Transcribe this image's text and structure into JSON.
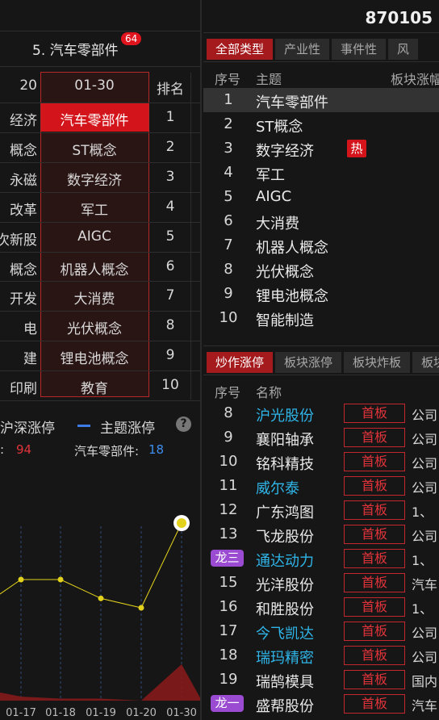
{
  "left": {
    "sector_title": "5. 汽车零部件",
    "sector_badge": "64",
    "header_left": "20",
    "header_mid": "01-30",
    "header_rank": "排名",
    "rows": [
      {
        "left": "经济",
        "mid": "汽车零部件",
        "rank": "1"
      },
      {
        "left": "概念",
        "mid": "ST概念",
        "rank": "2"
      },
      {
        "left": "永磁",
        "mid": "数字经济",
        "rank": "3"
      },
      {
        "left": "改革",
        "mid": "军工",
        "rank": "4"
      },
      {
        "left": "次新股",
        "mid": "AIGC",
        "rank": "5"
      },
      {
        "left": "概念",
        "mid": "机器人概念",
        "rank": "6"
      },
      {
        "left": "开发",
        "mid": "大消费",
        "rank": "7"
      },
      {
        "left": "电",
        "mid": "光伏概念",
        "rank": "8"
      },
      {
        "left": "建",
        "mid": "锂电池概念",
        "rank": "9"
      },
      {
        "left": "印刷",
        "mid": "教育",
        "rank": "10"
      }
    ],
    "legend_a": "沪深涨停",
    "legend_b": "主题涨停",
    "help_icon": "?",
    "stat_a_label": ":",
    "stat_a_value": "94",
    "stat_b_label": "汽车零部件:",
    "stat_b_value": "18"
  },
  "chart_data": {
    "type": "line",
    "x": [
      "01-17",
      "01-18",
      "01-19",
      "01-20",
      "01-30"
    ],
    "series": [
      {
        "values": [
          null,
          12,
          12,
          10,
          9,
          18
        ]
      }
    ],
    "colors": {
      "line": "#e3d21c",
      "area": "#8b1a1a",
      "grid": "#2f4a7a"
    }
  },
  "right": {
    "code": "870105",
    "theme_tabs": [
      "全部类型",
      "产业性",
      "事件性",
      "风"
    ],
    "theme_header": {
      "no": "序号",
      "name": "主题",
      "pct": "板块涨幅"
    },
    "themes": [
      {
        "no": "1",
        "name": "汽车零部件"
      },
      {
        "no": "2",
        "name": "ST概念"
      },
      {
        "no": "3",
        "name": "数字经济",
        "hot": "热"
      },
      {
        "no": "4",
        "name": "军工"
      },
      {
        "no": "5",
        "name": "AIGC"
      },
      {
        "no": "6",
        "name": "大消费"
      },
      {
        "no": "7",
        "name": "机器人概念"
      },
      {
        "no": "8",
        "name": "光伏概念"
      },
      {
        "no": "9",
        "name": "锂电池概念"
      },
      {
        "no": "10",
        "name": "智能制造"
      }
    ],
    "stock_tabs": [
      "炒作涨停",
      "板块涨停",
      "板块炸板",
      "板块"
    ],
    "stock_header": {
      "no": "序号",
      "name": "名称"
    },
    "stocks": [
      {
        "no": "8",
        "name": "沪光股份",
        "board": "首板",
        "reason": "公司",
        "color": "cyan"
      },
      {
        "no": "9",
        "name": "襄阳轴承",
        "board": "首板",
        "reason": "公司",
        "color": "white"
      },
      {
        "no": "10",
        "name": "铭科精技",
        "board": "首板",
        "reason": "公司",
        "color": "white"
      },
      {
        "no": "11",
        "name": "威尔泰",
        "board": "首板",
        "reason": "公司",
        "color": "cyan"
      },
      {
        "no": "12",
        "name": "广东鸿图",
        "board": "首板",
        "reason": "1、",
        "color": "white"
      },
      {
        "no": "13",
        "name": "飞龙股份",
        "board": "首板",
        "reason": "公司",
        "color": "white"
      },
      {
        "no": "",
        "tag": "龙三",
        "name": "通达动力",
        "board": "首板",
        "reason": "1、",
        "color": "cyan"
      },
      {
        "no": "15",
        "name": "光洋股份",
        "board": "首板",
        "reason": "汽车",
        "color": "white"
      },
      {
        "no": "16",
        "name": "和胜股份",
        "board": "首板",
        "reason": "1、",
        "color": "white"
      },
      {
        "no": "17",
        "name": "今飞凯达",
        "board": "首板",
        "reason": "公司",
        "color": "cyan"
      },
      {
        "no": "18",
        "name": "瑞玛精密",
        "board": "首板",
        "reason": "公司",
        "color": "cyan"
      },
      {
        "no": "19",
        "name": "瑞鹄模具",
        "board": "首板",
        "reason": "国内",
        "color": "white"
      },
      {
        "no": "",
        "tag": "龙一",
        "name": "盛帮股份",
        "board": "首板",
        "reason": "汽车",
        "color": "white"
      }
    ]
  }
}
